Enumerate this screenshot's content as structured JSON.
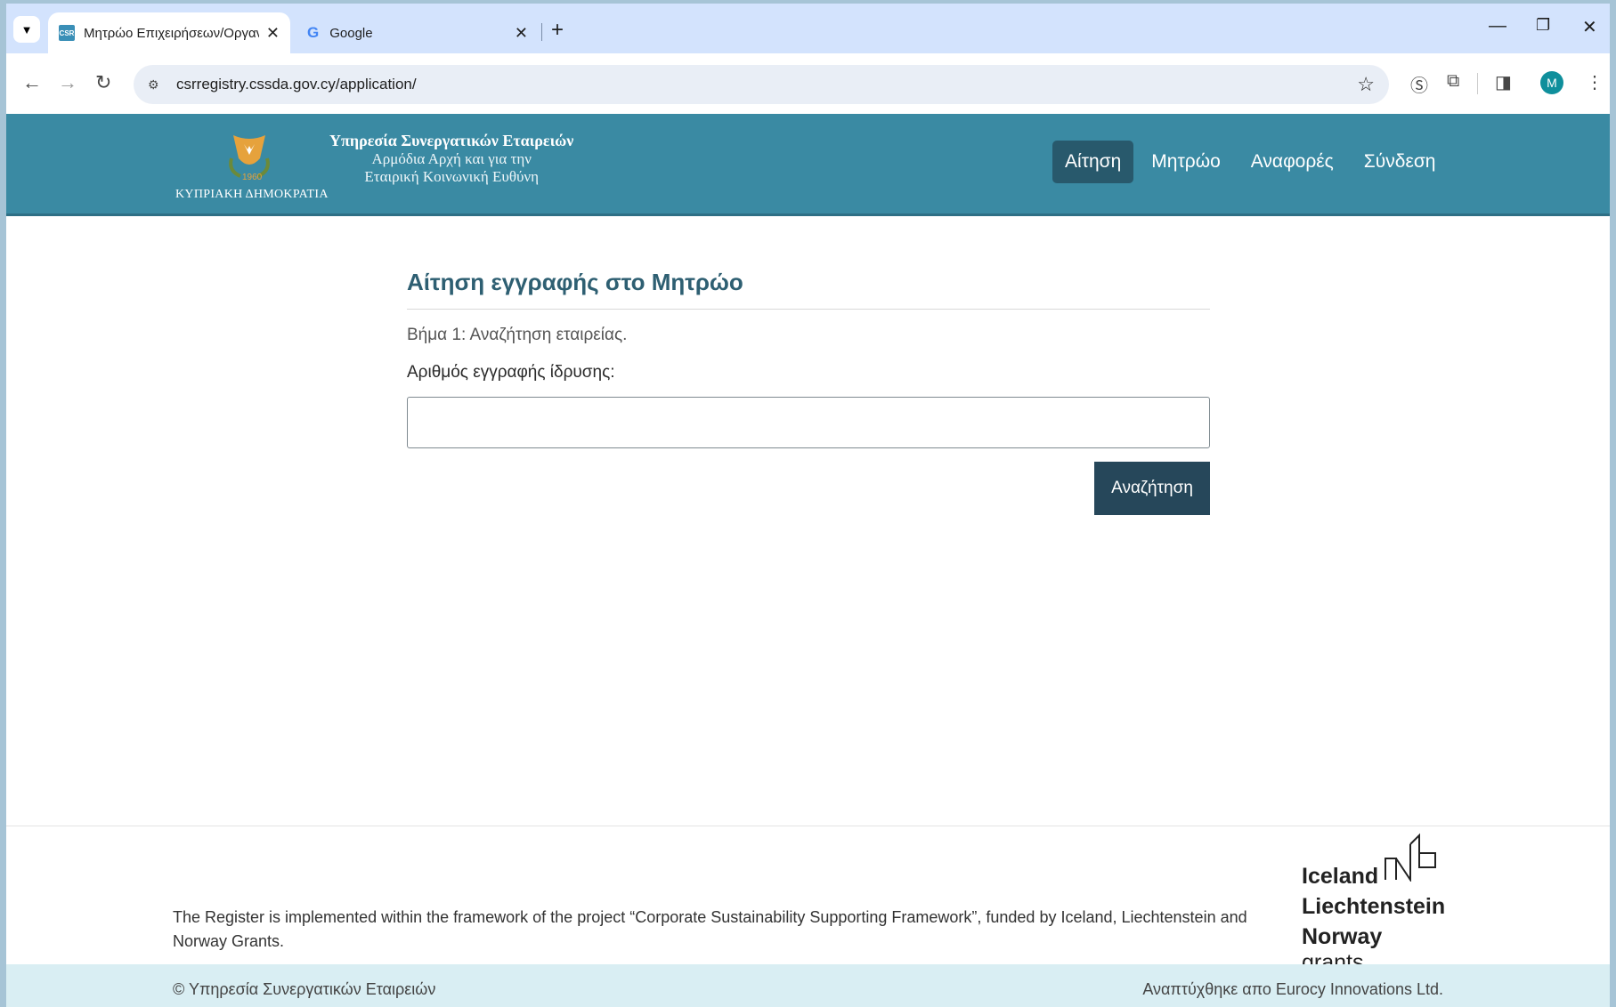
{
  "browser": {
    "tabs": [
      {
        "title": "Μητρώο Επιχειρήσεων/Οργανισμών",
        "favicon": "CSR",
        "active": true
      },
      {
        "title": "Google",
        "favicon": "G",
        "active": false
      }
    ],
    "url": "csrregistry.cssda.gov.cy/application/",
    "profile_initial": "M"
  },
  "header": {
    "republic": "ΚΥΠΡΙΑΚΗ ΔΗΜΟΚΡΑΤΙΑ",
    "org_line1": "Υπηρεσία Συνεργατικών Εταιρειών",
    "org_line2": "Αρμόδια Αρχή και για την",
    "org_line3": "Εταιρική Κοινωνική Ευθύνη",
    "nav": [
      "Αίτηση",
      "Μητρώο",
      "Αναφορές",
      "Σύνδεση"
    ]
  },
  "main": {
    "title": "Αίτηση εγγραφής στο Μητρώο",
    "step": "Βήμα 1: Αναζήτηση εταιρείας.",
    "field_label": "Αριθμός εγγραφής ίδρυσης:",
    "field_value": "",
    "search_button": "Αναζήτηση"
  },
  "footer": {
    "text": "The Register is implemented within the framework of the project “Corporate Sustainability Supporting Framework”, funded by Iceland, Liechtenstein and Norway Grants.",
    "grants_line1": "Iceland",
    "grants_line2": "Liechtenstein",
    "grants_line3a": "Norway",
    "grants_line3b": "grants",
    "copyright": "© Υπηρεσία Συνεργατικών Εταιρειών",
    "developer": "Αναπτύχθηκε απο Eurocy Innovations Ltd."
  },
  "colors": {
    "header_bg": "#3a8aa3",
    "nav_active": "#28596c",
    "button_bg": "#26475a",
    "title": "#2e5f72"
  }
}
